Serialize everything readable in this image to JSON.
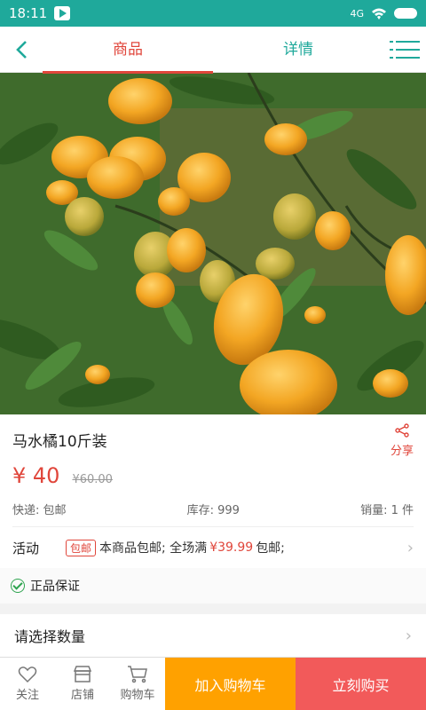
{
  "status": {
    "time": "18:11",
    "network": "4G"
  },
  "header": {
    "tabs": [
      "商品",
      "详情"
    ]
  },
  "product": {
    "title": "马水橘10斤装",
    "share_label": "分享",
    "price": "¥ 40",
    "old_price": "¥60.00",
    "shipping": "快递: 包邮",
    "stock": "库存: 999",
    "sales": "销量: 1 件"
  },
  "activity": {
    "label": "活动",
    "badge": "包邮",
    "text_before": "本商品包邮; 全场满",
    "highlight": "¥39.99",
    "text_after": "包邮;"
  },
  "guarantee": "正品保证",
  "quantity": {
    "label": "请选择数量"
  },
  "bottom_bar": {
    "follow": "关注",
    "store": "店铺",
    "cart": "购物车",
    "add_to_cart": "加入购物车",
    "buy_now": "立刻购买"
  },
  "colors": {
    "teal": "#1fa99b",
    "red": "#e0463b",
    "orange": "#ffa100"
  }
}
